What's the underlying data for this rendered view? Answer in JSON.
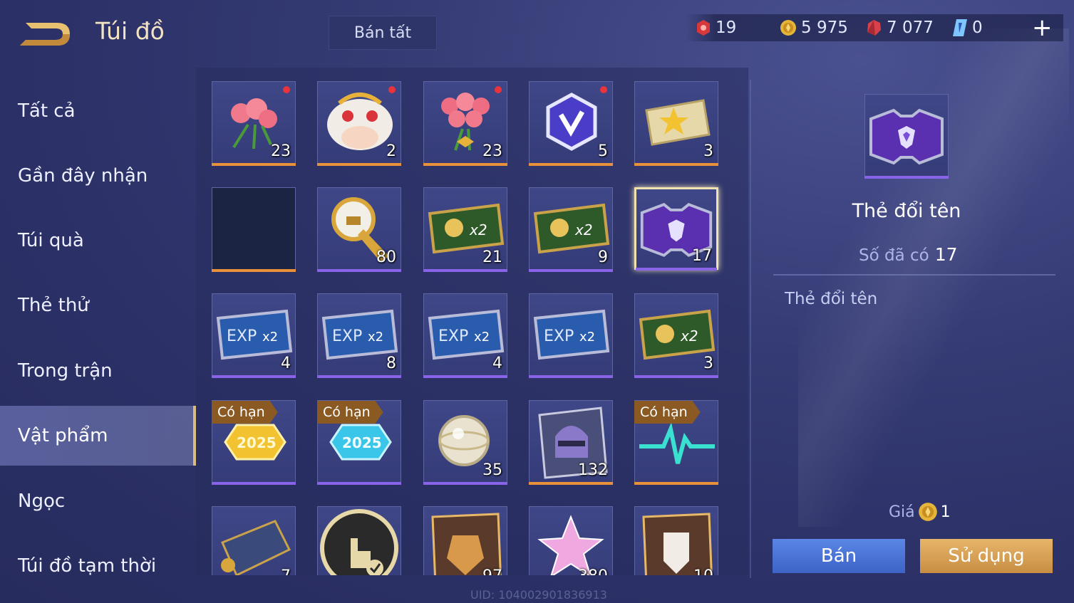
{
  "header": {
    "title": "Túi đồ",
    "sell_all": "Bán tất",
    "currencies": [
      {
        "icon": "red-token-icon",
        "value": "19"
      },
      {
        "icon": "gold-coin-icon",
        "value": "5 975"
      },
      {
        "icon": "ruby-gem-icon",
        "value": "7 077"
      },
      {
        "icon": "blue-voucher-icon",
        "value": "0"
      }
    ],
    "add": "+"
  },
  "sidebar": {
    "items": [
      {
        "label": "Tất cả"
      },
      {
        "label": "Gần đây nhận"
      },
      {
        "label": "Túi quà"
      },
      {
        "label": "Thẻ thử"
      },
      {
        "label": "Trong trận"
      },
      {
        "label": "Vật phẩm"
      },
      {
        "label": "Ngọc"
      },
      {
        "label": "Túi đồ tạm thời"
      }
    ],
    "active_index": 5
  },
  "grid": {
    "items": [
      {
        "icon": "rose-bouquet-icon",
        "qty": "23",
        "new": true,
        "rarity": "orange"
      },
      {
        "icon": "lion-dance-emote-icon",
        "qty": "2",
        "new": true,
        "rarity": "orange"
      },
      {
        "icon": "large-rose-bouquet-icon",
        "qty": "23",
        "new": true,
        "rarity": "orange"
      },
      {
        "icon": "hexagon-badge-icon",
        "qty": "5",
        "new": true,
        "rarity": "orange"
      },
      {
        "icon": "gold-star-ticket-icon",
        "qty": "3",
        "new": false,
        "rarity": "orange"
      },
      {
        "icon": "empty-slot",
        "qty": "",
        "new": false,
        "rarity": "orange"
      },
      {
        "icon": "golden-horn-icon",
        "qty": "80",
        "new": false,
        "rarity": "purple"
      },
      {
        "icon": "gold-x2-card-icon",
        "qty": "21",
        "new": false,
        "rarity": "purple"
      },
      {
        "icon": "gold-x2-card-icon",
        "qty": "9",
        "new": false,
        "rarity": "purple"
      },
      {
        "icon": "rename-card-icon",
        "qty": "17",
        "new": false,
        "rarity": "purple",
        "selected": true
      },
      {
        "icon": "exp-x2-card-icon",
        "qty": "4",
        "new": false,
        "rarity": "purple"
      },
      {
        "icon": "exp-x2-card-icon",
        "qty": "8",
        "new": false,
        "rarity": "purple"
      },
      {
        "icon": "exp-x2-card-icon",
        "qty": "4",
        "new": false,
        "rarity": "purple"
      },
      {
        "icon": "exp-x2-card-icon",
        "qty": "",
        "new": false,
        "rarity": "purple"
      },
      {
        "icon": "gold-x2-card-icon",
        "qty": "3",
        "new": false,
        "rarity": "purple"
      },
      {
        "icon": "gold-2025-badge-icon",
        "qty": "",
        "new": false,
        "rarity": "purple",
        "tag": "Có hạn"
      },
      {
        "icon": "blue-2025-badge-icon",
        "qty": "",
        "new": false,
        "rarity": "purple",
        "tag": "Có hạn"
      },
      {
        "icon": "crystal-orb-icon",
        "qty": "35",
        "new": false,
        "rarity": "purple"
      },
      {
        "icon": "knight-helmet-icon",
        "qty": "132",
        "new": false,
        "rarity": "orange"
      },
      {
        "icon": "pulse-wave-icon",
        "qty": "",
        "new": false,
        "rarity": "orange",
        "tag": "Có hạn"
      },
      {
        "icon": "scroll-map-icon",
        "qty": "7",
        "new": false,
        "rarity": "none"
      },
      {
        "icon": "touch-check-icon",
        "qty": "",
        "new": false,
        "rarity": "none"
      },
      {
        "icon": "golden-armor-icon",
        "qty": "97",
        "new": false,
        "rarity": "none"
      },
      {
        "icon": "pink-star-crystal-icon",
        "qty": "380",
        "new": false,
        "rarity": "none"
      },
      {
        "icon": "armor-emblem-icon",
        "qty": "10",
        "new": false,
        "rarity": "none"
      }
    ]
  },
  "uid": "UID: 104002901836913",
  "detail": {
    "icon": "rename-card-icon",
    "name": "Thẻ đổi tên",
    "owned_label": "Số đã có",
    "owned_value": "17",
    "description": "Thẻ đổi tên",
    "price_label": "Giá",
    "price_value": "1",
    "sell_button": "Bán",
    "use_button": "Sử dụng"
  },
  "colors": {
    "orange_bar": "#e8913a",
    "purple_bar": "#8a64e8",
    "accent_gold": "#d8bb84"
  }
}
